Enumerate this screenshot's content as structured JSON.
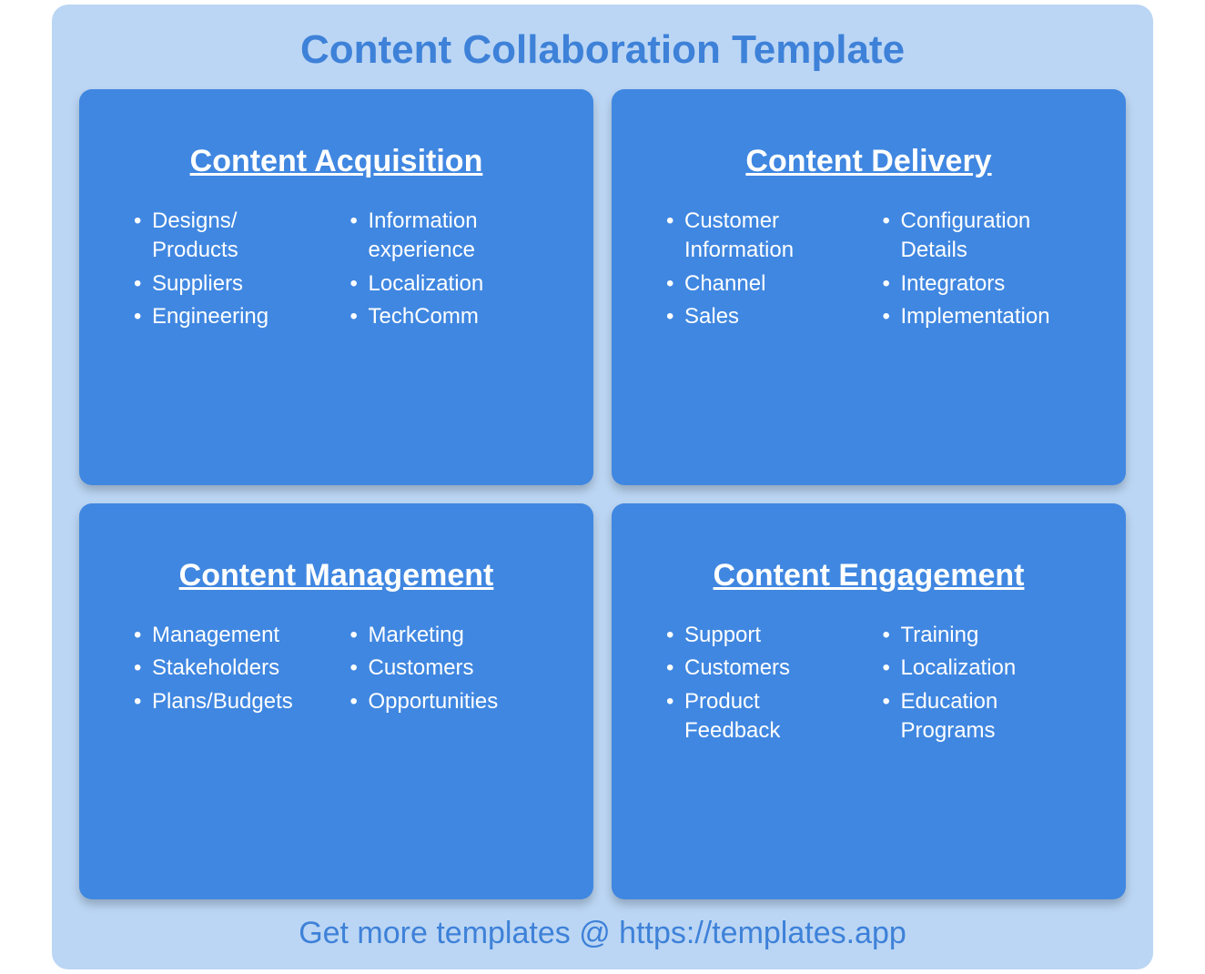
{
  "title": "Content Collaboration Template",
  "footer": "Get more templates @ https://templates.app",
  "cards": [
    {
      "title": "Content Acquisition",
      "col1": [
        "Designs/\nProducts",
        "Suppliers",
        "Engineering"
      ],
      "col2": [
        "Information\nexperience",
        "Localization",
        "TechComm"
      ]
    },
    {
      "title": "Content Delivery",
      "col1": [
        "Customer\nInformation",
        "Channel",
        "Sales"
      ],
      "col2": [
        "Configuration\nDetails",
        "Integrators",
        "Implementation"
      ]
    },
    {
      "title": "Content Management",
      "col1": [
        "Management",
        "Stakeholders",
        "Plans/Budgets"
      ],
      "col2": [
        "Marketing",
        "Customers",
        "Opportunities"
      ]
    },
    {
      "title": "Content Engagement",
      "col1": [
        "Support",
        "Customers",
        "Product\nFeedback"
      ],
      "col2": [
        "Training",
        "Localization",
        "Education\nPrograms"
      ]
    }
  ]
}
